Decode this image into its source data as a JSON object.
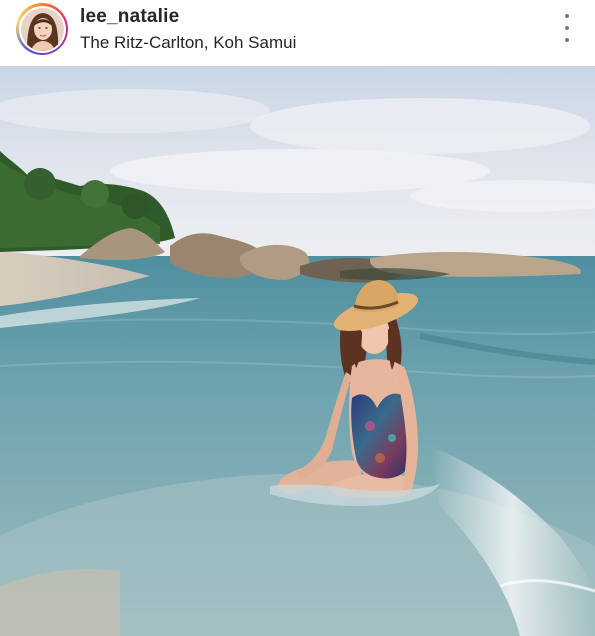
{
  "post": {
    "username": "lee_natalie",
    "location": "The Ritz-Carlton, Koh Samui"
  },
  "icons": {
    "avatar": "profile-photo",
    "more": "more-options-vertical-dots-icon"
  },
  "colors": {
    "story_ring_start": "#f58529",
    "story_ring_mid": "#dd2a7b",
    "story_ring_end": "#8134af",
    "text": "#262626"
  }
}
